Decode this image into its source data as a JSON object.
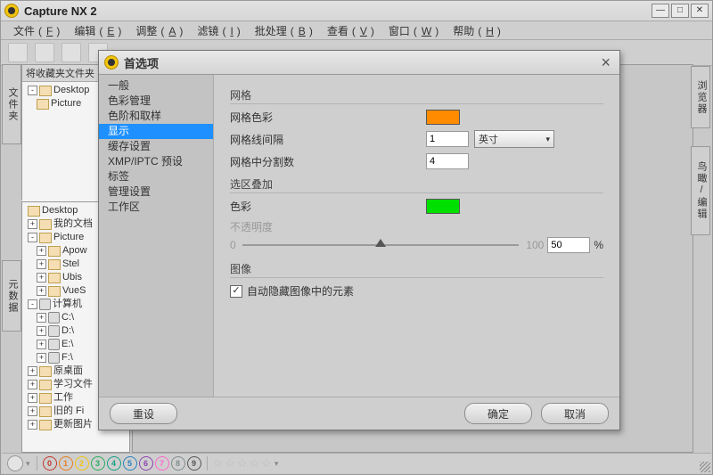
{
  "app": {
    "title": "Capture NX 2"
  },
  "menu": {
    "file": {
      "label": "文件",
      "letter": "F"
    },
    "edit": {
      "label": "编辑",
      "letter": "E"
    },
    "adjust": {
      "label": "调整",
      "letter": "A"
    },
    "filter": {
      "label": "滤镜",
      "letter": "I"
    },
    "batch": {
      "label": "批处理",
      "letter": "B"
    },
    "view": {
      "label": "查看",
      "letter": "V"
    },
    "window": {
      "label": "窗口",
      "letter": "W"
    },
    "help": {
      "label": "帮助",
      "letter": "H"
    }
  },
  "panes": {
    "favorites_title": "将收藏夹文件夹",
    "left_tab_folders": "文件夹",
    "left_tab_meta": "元数据",
    "right_tab_browser": "浏览器",
    "right_tab_bird": "鸟瞰/编辑"
  },
  "tree1": {
    "r0": "Desktop",
    "r1": "Picture"
  },
  "tree2": {
    "r0": "Desktop",
    "r1": "我的文档",
    "r2": "Picture",
    "r3": "Apow",
    "r4": "Stel",
    "r5": "Ubis",
    "r6": "VueS",
    "r7": "计算机",
    "r8": "C:\\",
    "r9": "D:\\",
    "r10": "E:\\",
    "r11": "F:\\",
    "r12": "原桌面",
    "r13": "学习文件",
    "r14": "工作",
    "r15": "旧的 Fi",
    "r16": "更新图片"
  },
  "dialog": {
    "title": "首选项",
    "nav": {
      "n0": "一般",
      "n1": "色彩管理",
      "n2": "色阶和取样",
      "n3": "显示",
      "n4": "缓存设置",
      "n5": "XMP/IPTC 预设",
      "n6": "标签",
      "n7": "管理设置",
      "n8": "工作区"
    },
    "grid": {
      "section": "网格",
      "color_label": "网格色彩",
      "color_value": "#ff8c00",
      "spacing_label": "网格线间隔",
      "spacing_value": "1",
      "spacing_unit": "英寸",
      "subdiv_label": "网格中分割数",
      "subdiv_value": "4"
    },
    "overlay": {
      "section": "选区叠加",
      "color_label": "色彩",
      "color_value": "#00e000",
      "opacity_label": "不透明度",
      "min": "0",
      "max": "100",
      "value": "50",
      "pct": "%"
    },
    "image": {
      "section": "图像",
      "auto_hide": "自动隐藏图像中的元素"
    },
    "buttons": {
      "reset": "重设",
      "ok": "确定",
      "cancel": "取消"
    }
  },
  "status": {
    "nums": [
      "0",
      "1",
      "2",
      "3",
      "4",
      "5",
      "6",
      "7",
      "8",
      "9"
    ],
    "colors": [
      "#c0392b",
      "#e67e22",
      "#f1c40f",
      "#27ae60",
      "#16a085",
      "#2980b9",
      "#8e44ad",
      "#ff66cc",
      "#7f8c8d",
      "#555555"
    ]
  }
}
